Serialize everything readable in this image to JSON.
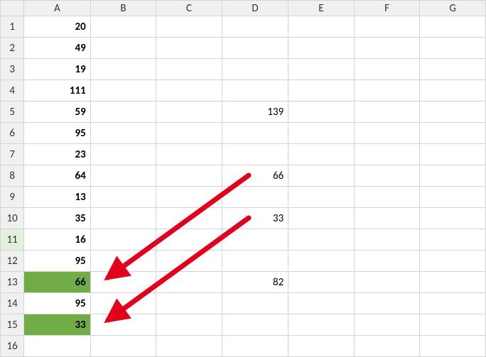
{
  "columns": [
    "A",
    "B",
    "C",
    "D",
    "E",
    "F",
    "G"
  ],
  "rows": [
    "1",
    "2",
    "3",
    "4",
    "5",
    "6",
    "7",
    "8",
    "9",
    "10",
    "11",
    "12",
    "13",
    "14",
    "15",
    "16"
  ],
  "activeRow": 11,
  "highlightRows": [
    13,
    15
  ],
  "cells": {
    "A": {
      "1": "20",
      "2": "49",
      "3": "19",
      "4": "111",
      "5": "59",
      "6": "95",
      "7": "23",
      "8": "64",
      "9": "13",
      "10": "35",
      "11": "16",
      "12": "95",
      "13": "66",
      "14": "95",
      "15": "33"
    },
    "D": {
      "5": "139",
      "8": "66",
      "10": "33",
      "13": "82"
    }
  },
  "arrows": [
    {
      "from": {
        "col": "D",
        "row": 8
      },
      "to": {
        "col": "A",
        "row": 13
      },
      "label_from": "66",
      "label_to": "66"
    },
    {
      "from": {
        "col": "D",
        "row": 10
      },
      "to": {
        "col": "A",
        "row": 15
      },
      "label_from": "33",
      "label_to": "33"
    }
  ],
  "chart_data": null
}
